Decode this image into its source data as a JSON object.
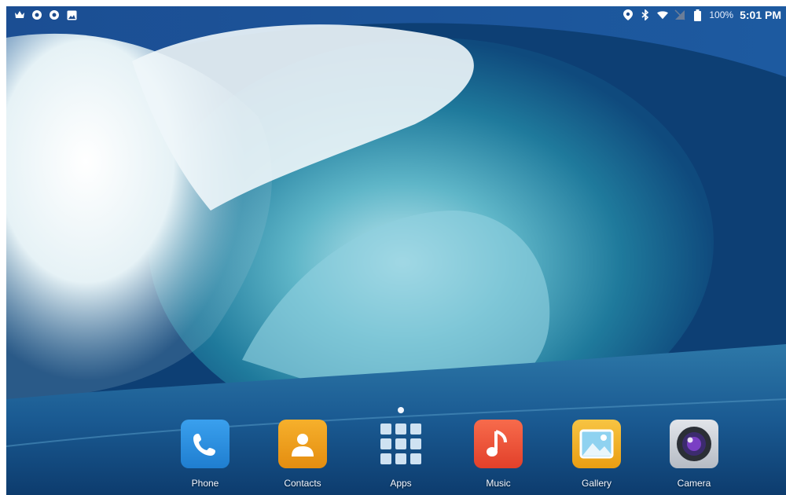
{
  "status_bar": {
    "left_icons": [
      "crown-icon",
      "sync-icon",
      "sync-icon",
      "image-icon"
    ],
    "right_icons": [
      "location-icon",
      "bluetooth-icon",
      "wifi-icon",
      "no-signal-icon",
      "battery-icon"
    ],
    "battery_percent": "100%",
    "time": "5:01 PM"
  },
  "home": {
    "page_count": 1,
    "active_page": 1
  },
  "dock": {
    "apps": [
      {
        "label": "Phone",
        "icon": "phone-icon",
        "color": "#2f8fe0"
      },
      {
        "label": "Contacts",
        "icon": "contacts-icon",
        "color": "#f1a21c"
      },
      {
        "label": "Apps",
        "icon": "apps-grid-icon",
        "color": "transparent"
      },
      {
        "label": "Music",
        "icon": "music-icon",
        "color": "#f0523a"
      },
      {
        "label": "Gallery",
        "icon": "gallery-icon",
        "color": "#f3b21f"
      },
      {
        "label": "Camera",
        "icon": "camera-icon",
        "color": "#c9ced6"
      }
    ]
  }
}
